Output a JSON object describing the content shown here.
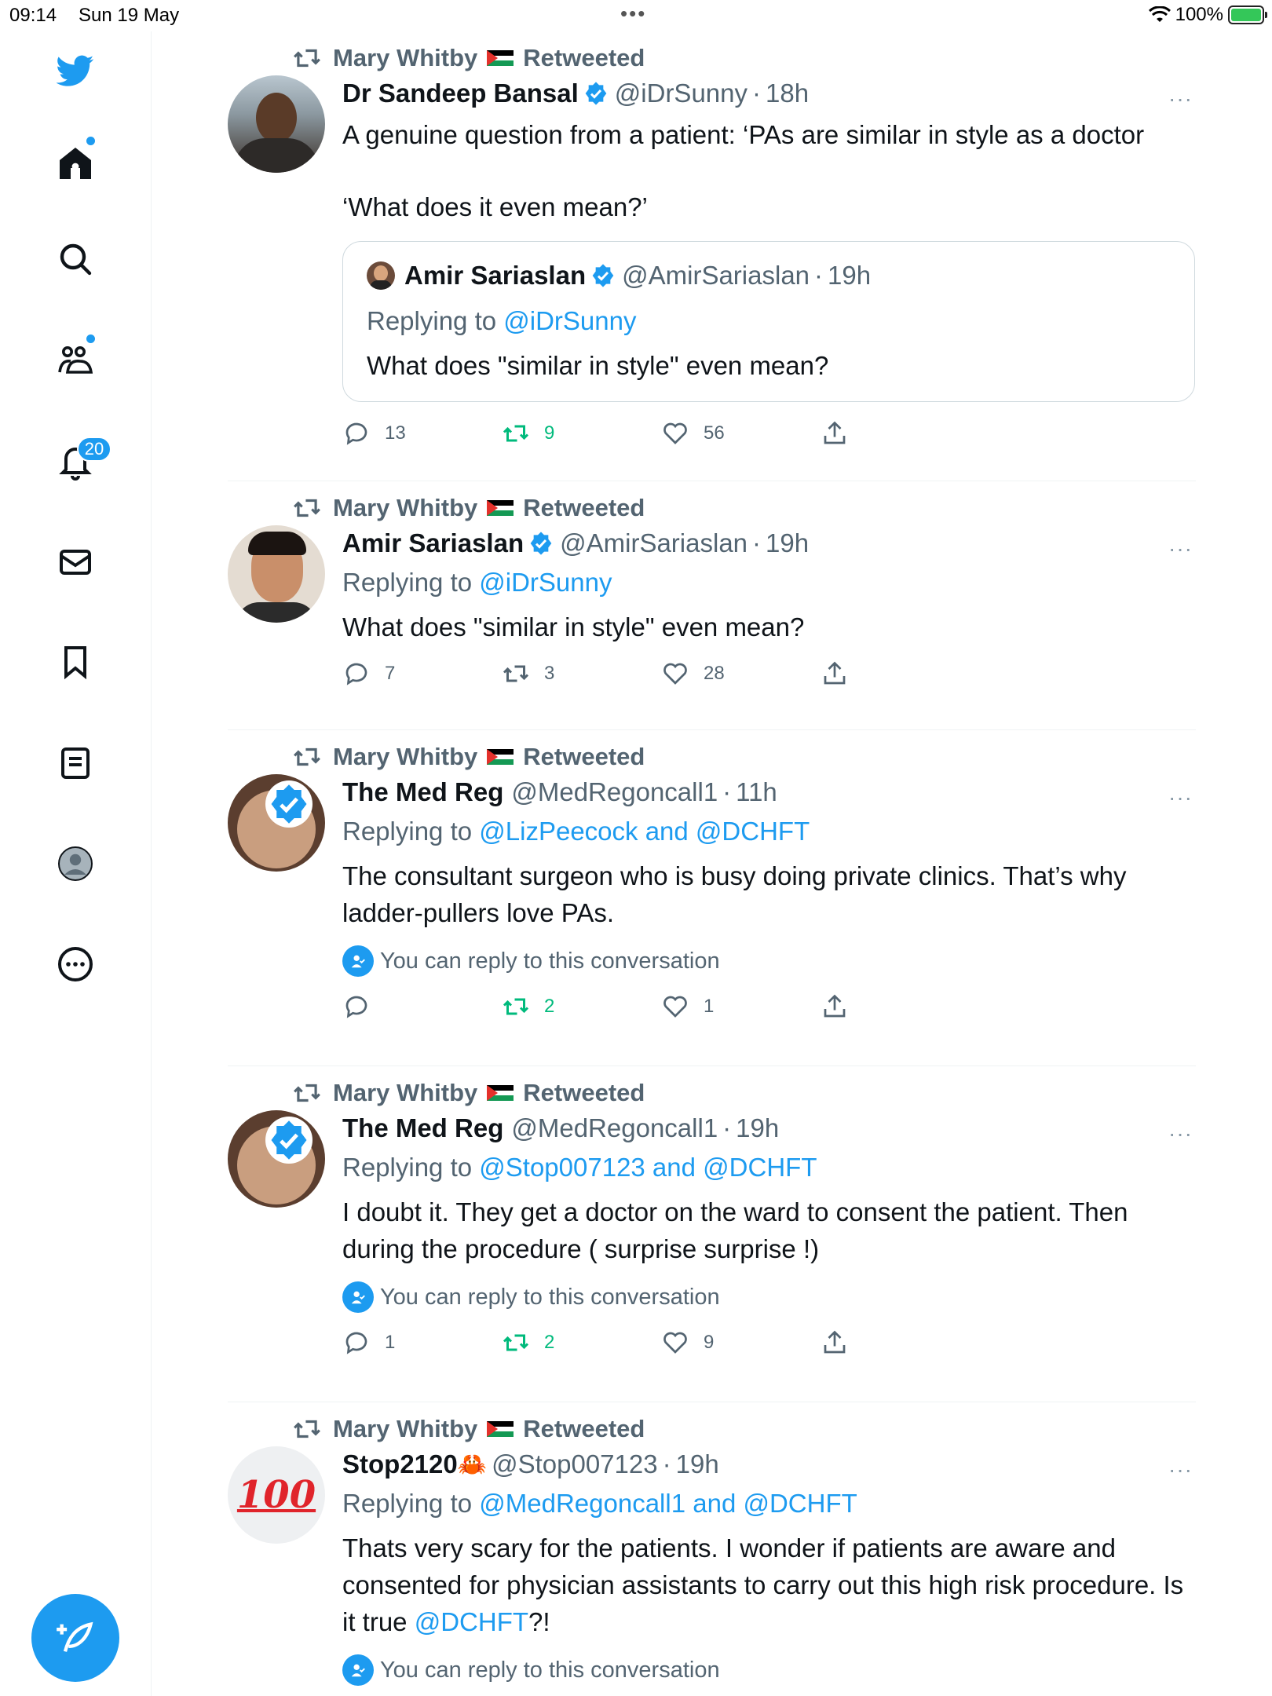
{
  "status_bar": {
    "time": "09:14",
    "date": "Sun 19 May",
    "battery": "100%"
  },
  "sidebar": {
    "notifications_badge": "20",
    "items": [
      "twitter-logo",
      "home-icon",
      "search-icon",
      "communities-icon",
      "notifications-icon",
      "messages-icon",
      "bookmarks-icon",
      "lists-icon",
      "profile-icon",
      "more-icon"
    ],
    "compose": "compose-icon"
  },
  "colors": {
    "accent": "#1d9bf0",
    "retweet_green": "#00ba7c",
    "secondary_text": "#536471"
  },
  "tweets": [
    {
      "retweeter": "Mary Whitby",
      "retweeted_label": "Retweeted",
      "name": "Dr Sandeep Bansal",
      "handle": "@iDrSunny",
      "time": "18h",
      "text_1": "A genuine question from a patient: ‘PAs are similar in style as a doctor",
      "text_2": "‘What does it even mean?’",
      "quote": {
        "name": "Amir Sariaslan",
        "handle": "@AmirSariaslan",
        "time": "19h",
        "replying_prefix": "Replying to ",
        "replying_to": "@iDrSunny",
        "text": "What does \"similar in style\" even mean?"
      },
      "replies": "13",
      "retweets": "9",
      "likes": "56"
    },
    {
      "retweeter": "Mary Whitby",
      "retweeted_label": "Retweeted",
      "name": "Amir Sariaslan",
      "handle": "@AmirSariaslan",
      "time": "19h",
      "replying_prefix": "Replying to ",
      "replying_to": "@iDrSunny",
      "text": "What does \"similar in style\" even mean?",
      "replies": "7",
      "retweets": "3",
      "likes": "28"
    },
    {
      "retweeter": "Mary Whitby",
      "retweeted_label": "Retweeted",
      "name": "The Med Reg",
      "handle": "@MedRegoncall1",
      "time": "11h",
      "replying_prefix": "Replying to ",
      "replying_to": "@LizPeecock and @DCHFT",
      "text": "The consultant surgeon who is busy doing private clinics. That’s why ladder-pullers love PAs.",
      "conversation": "You can reply to this conversation",
      "replies": "",
      "retweets": "2",
      "likes": "1"
    },
    {
      "retweeter": "Mary Whitby",
      "retweeted_label": "Retweeted",
      "name": "The Med Reg",
      "handle": "@MedRegoncall1",
      "time": "19h",
      "replying_prefix": "Replying to ",
      "replying_to": "@Stop007123 and @DCHFT",
      "text": "I doubt it. They get a doctor on the ward to consent the patient. Then during the procedure ( surprise surprise !)",
      "conversation": "You can reply to this conversation",
      "replies": "1",
      "retweets": "2",
      "likes": "9"
    },
    {
      "retweeter": "Mary Whitby",
      "retweeted_label": "Retweeted",
      "name": "Stop2120",
      "name_emoji": "🦀",
      "handle": "@Stop007123",
      "time": "19h",
      "avatar_text": "100",
      "replying_prefix": "Replying to ",
      "replying_to": "@MedRegoncall1 and @DCHFT",
      "text_main": "Thats very scary for the patients. I wonder if patients are aware and consented for  physician assistants to carry out this high risk procedure. Is it true ",
      "text_link": "@DCHFT",
      "text_end": "?!",
      "conversation": "You can reply to this conversation"
    }
  ],
  "separator": "·",
  "more_glyph": "···"
}
